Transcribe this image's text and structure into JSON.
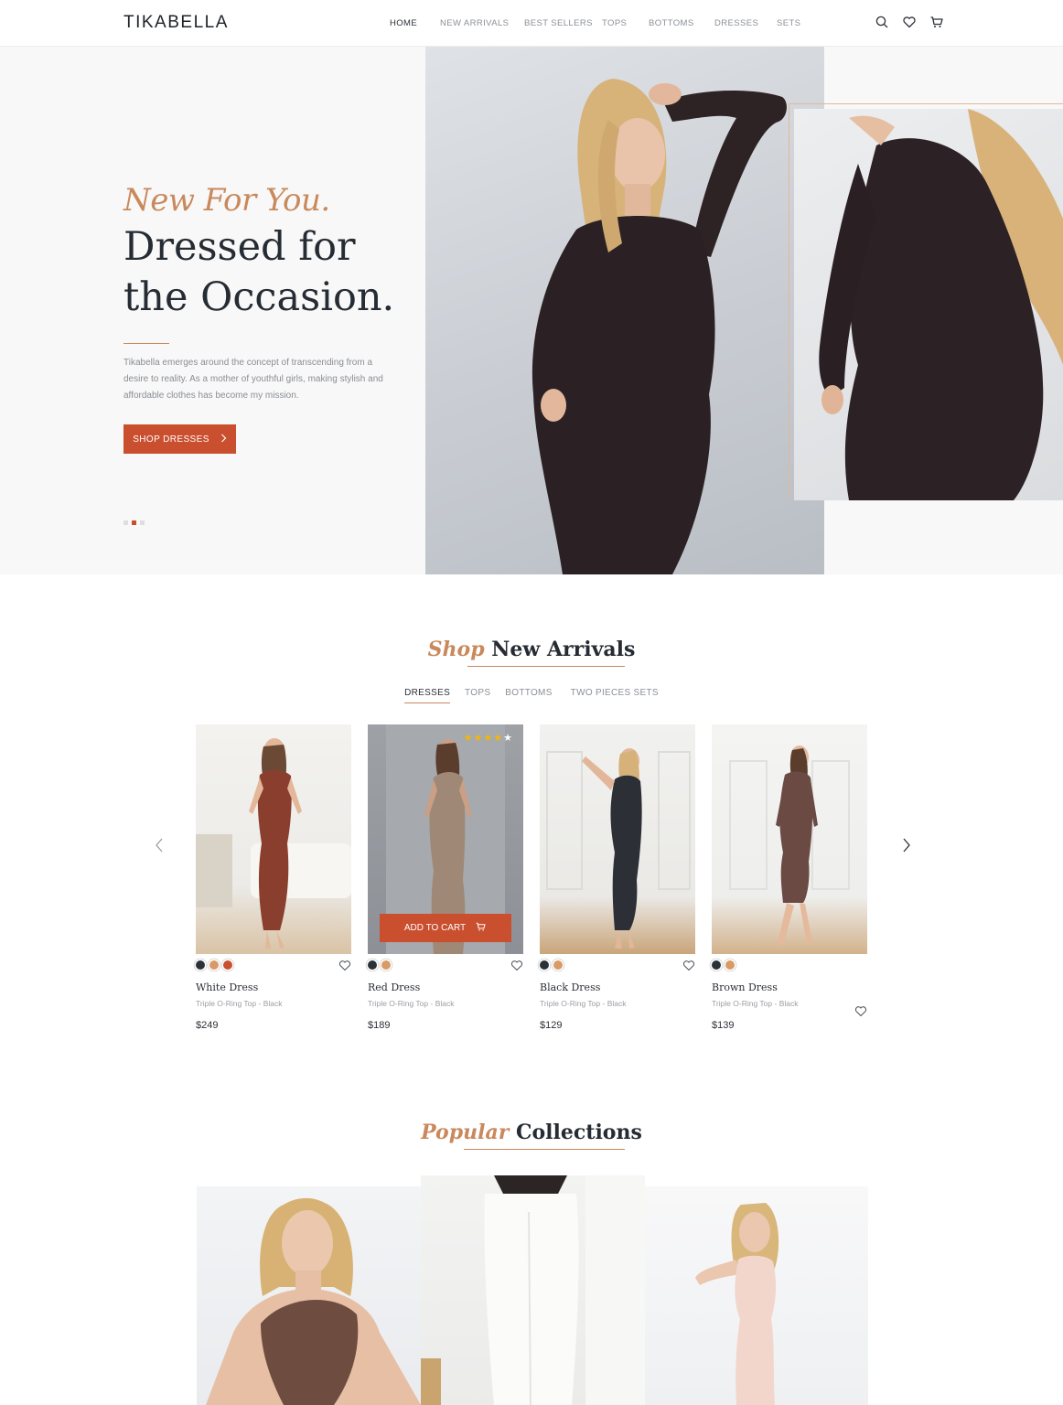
{
  "brand": {
    "logo": "TIKABELLA"
  },
  "nav": {
    "items": [
      "HOME",
      "NEW ARRIVALS",
      "BEST SELLERS",
      "TOPS",
      "BOTTOMS",
      "DRESSES",
      "SETS"
    ],
    "active": "HOME"
  },
  "header_icons": [
    "search-icon",
    "heart-icon",
    "cart-icon"
  ],
  "hero": {
    "eyebrow": "New For You.",
    "title_line1": "Dressed for",
    "title_line2": "the Occasion.",
    "description": "Tikabella emerges around the concept of transcending from a desire to reality. As a mother of youthful girls, making stylish and affordable clothes has become my mission.",
    "cta": "SHOP DRESSES",
    "slides": 3,
    "active_slide": 2
  },
  "new_arrivals": {
    "title_accent": "Shop",
    "title_rest": "New Arrivals",
    "tabs": [
      "DRESSES",
      "TOPS",
      "BOTTOMS",
      "TWO PIECES SETS"
    ],
    "active_tab": "DRESSES",
    "add_to_cart": "ADD TO CART",
    "products": [
      {
        "name": "White Dress",
        "subtitle": "Triple O-Ring Top - Black",
        "price": "$249",
        "swatches": [
          "#2c3138",
          "#d99a66",
          "#c94f2f"
        ],
        "dress_color": "#8a3f2e"
      },
      {
        "name": "Red Dress",
        "subtitle": "Triple O-Ring Top - Black",
        "price": "$189",
        "swatches": [
          "#2c3138",
          "#d99a66"
        ],
        "rating": 4,
        "rating_max": 5,
        "dress_color": "#a08876"
      },
      {
        "name": "Black Dress",
        "subtitle": "Triple O-Ring Top - Black",
        "price": "$129",
        "swatches": [
          "#2c3138",
          "#d99a66"
        ],
        "dress_color": "#2c2f36"
      },
      {
        "name": "Brown Dress",
        "subtitle": "Triple O-Ring Top - Black",
        "price": "$139",
        "swatches": [
          "#2c3138",
          "#d99a66"
        ],
        "dress_color": "#6b4a44"
      }
    ]
  },
  "collections": {
    "title_accent": "Popular",
    "title_rest": "Collections"
  },
  "colors": {
    "accent": "#c94f2f",
    "gold": "#c9895c",
    "ink": "#262c33",
    "muted": "#8b8f96"
  }
}
